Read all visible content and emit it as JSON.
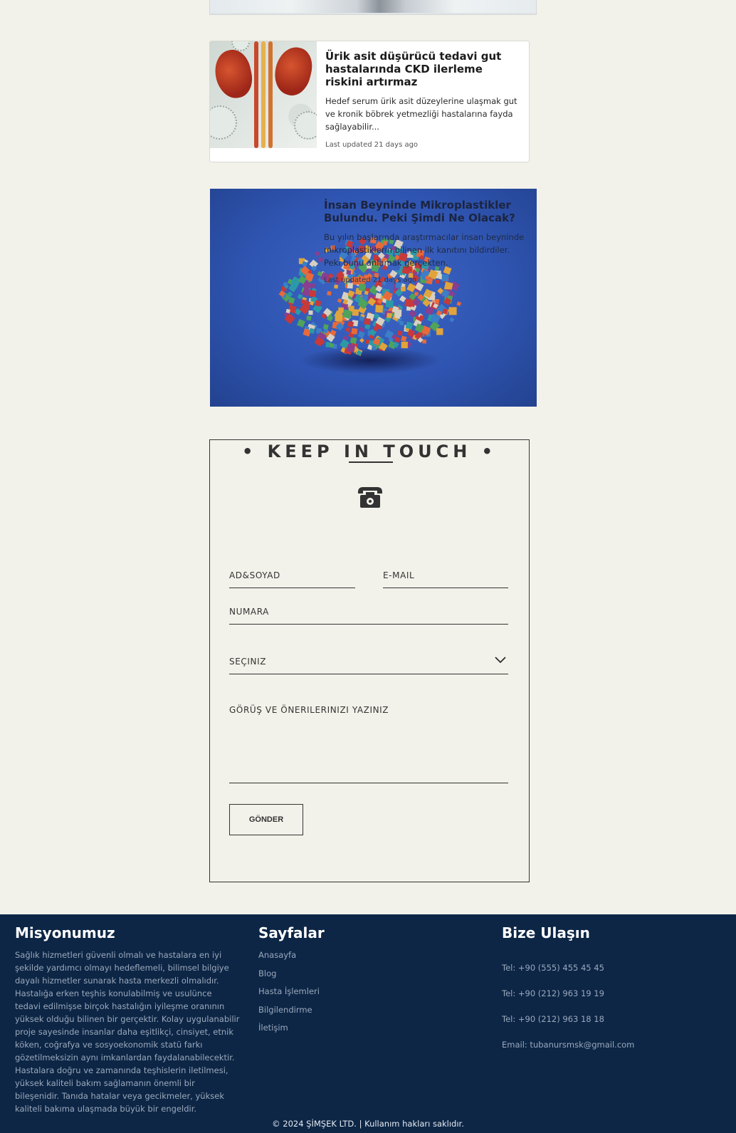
{
  "article_card": {
    "title": "Ürik asit düşürücü tedavi gut hastalarında CKD ilerleme riskini artırmaz",
    "excerpt": "Hedef serum ürik asit düzeylerine ulaşmak gut ve kronik böbrek yetmezliği hastalarına fayda sağlayabilir...",
    "meta": "Last updated 21 days ago"
  },
  "hero_card": {
    "title": "İnsan Beyninde Mikroplastikler Bulundu. Peki Şimdi Ne Olacak?",
    "excerpt": "Bu yılın başlarında araştırmacılar insan beyninde mikroplastiklerin bilinen ilk kanıtını bildirdiler. Peki bunu anlamak gerçekten.",
    "meta": "Last updated 21 days ago"
  },
  "contact": {
    "heading": "• KEEP IN TOUCH •",
    "icon": "telephone-icon",
    "fields": {
      "name": "AD&SOYAD",
      "email": "E-MAIL",
      "phone": "NUMARA",
      "select": "SEÇINIZ",
      "message": "GÖRÜŞ VE ÖNERILERINIZI YAZINIZ"
    },
    "submit_label": "GÖNDER"
  },
  "footer": {
    "mission": {
      "title": "Misyonumuz",
      "text": "Sağlık hizmetleri güvenli olmalı ve hastalara en iyi şekilde yardımcı olmayı hedeflemeli, bilimsel bilgiye dayalı hizmetler sunarak hasta merkezli olmalıdır. Hastalığa erken teşhis konulabilmiş ve usulünce tedavi edilmişse birçok hastalığın iyileşme oranının yüksek olduğu bilinen bir gerçektir. Kolay uygulanabilir proje sayesinde insanlar daha eşitlikçi, cinsiyet, etnik köken, coğrafya ve sosyoekonomik statü farkı gözetilmeksizin aynı imkanlardan faydalanabilecektir. Hastalara doğru ve zamanında teşhislerin iletilmesi, yüksek kaliteli bakım sağlamanın önemli bir bileşenidir. Tanıda hatalar veya gecikmeler, yüksek kaliteli bakıma ulaşmada büyük bir engeldir."
    },
    "pages": {
      "title": "Sayfalar",
      "links": [
        "Anasayfa",
        "Blog",
        "Hasta İşlemleri",
        "Bilgilendirme",
        "İletişim"
      ]
    },
    "reach": {
      "title": "Bize Ulaşın",
      "items": [
        "Tel: +90 (555) 455 45 45",
        "Tel: +90 (212) 963 19 19",
        "Tel: +90 (212) 963 18 18",
        "Email: tubanursmsk@gmail.com"
      ]
    },
    "copyright": "© 2024 ŞİMŞEK LTD. | Kullanım hakları saklıdır."
  }
}
